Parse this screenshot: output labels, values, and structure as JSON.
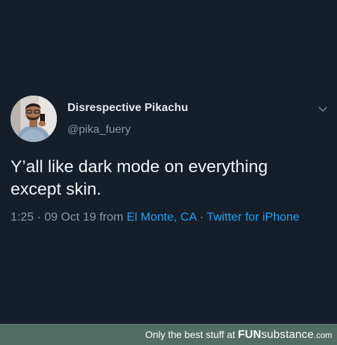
{
  "tweet": {
    "display_name": "Disrespective Pikachu",
    "handle": "@pika_fuery",
    "text": "Y’all like dark mode on everything\nexcept skin.",
    "time": "1:25",
    "separator": " · ",
    "date": "09 Oct 19",
    "from_label": " from ",
    "location": "El Monte, CA",
    "source": "Twitter for iPhone",
    "more_icon": "chevron-down-icon",
    "avatar": "profile-photo"
  },
  "footer": {
    "tagline": "Only the best stuff at ",
    "brand_bold": "FUN",
    "brand_light": "substance",
    "brand_tld": ".com"
  },
  "colors": {
    "background": "#151e29",
    "name": "#e6ebef",
    "secondary": "#8899a6",
    "link": "#1da1f2",
    "footer_bg": "#526d64"
  }
}
